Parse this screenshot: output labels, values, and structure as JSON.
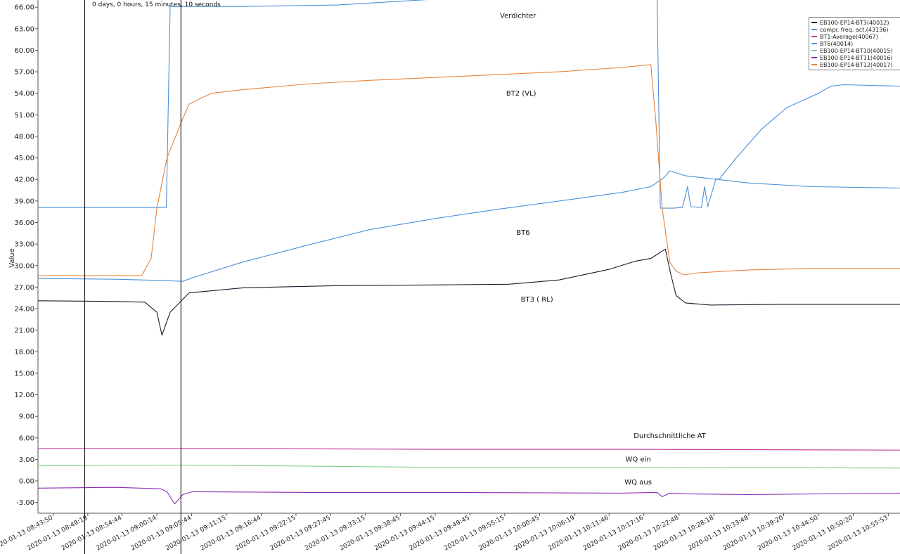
{
  "chart_data": {
    "type": "line",
    "title": "",
    "xlabel": "",
    "ylabel": "Value",
    "ylim": [
      -4.5,
      67
    ],
    "y_ticks": [
      "66.00",
      "63.00",
      "60.00",
      "57.00",
      "54.00",
      "51.00",
      "48.00",
      "45.00",
      "42.00",
      "39.00",
      "36.00",
      "33.00",
      "30.00",
      "27.00",
      "24.00",
      "21.00",
      "18.00",
      "15.00",
      "12.00",
      "9.00",
      "6.00",
      "3.00",
      "0.00",
      "-3.00"
    ],
    "x_ticks": [
      "2020-01-13 08:43:50",
      "2020-01-13 08:49:19",
      "2020-01-13 08:54:44",
      "2020-01-13 09:00:14",
      "2020-01-13 09:05:44",
      "2020-01-13 09:11:15",
      "2020-01-13 09:16:44",
      "2020-01-13 09:22:15",
      "2020-01-13 09:27:45",
      "2020-01-13 09:33:15",
      "2020-01-13 09:38:45",
      "2020-01-13 09:44:15",
      "2020-01-13 09:49:45",
      "2020-01-13 09:55:15",
      "2020-01-13 10:00:45",
      "2020-01-13 10:06:19",
      "2020-01-13 10:11:46",
      "2020-01-13 10:17:16",
      "2020-01-13 10:22:48",
      "2020-01-13 10:28:18",
      "2020-01-13 10:33:48",
      "2020-01-13 10:39:20",
      "2020-01-13 10:44:50",
      "2020-01-13 10:50:20",
      "2020-01-13 10:55:53"
    ],
    "x_minutes": [
      0,
      5.48,
      10.9,
      16.4,
      21.9,
      27.4,
      32.9,
      38.4,
      43.9,
      49.4,
      54.9,
      60.4,
      65.9,
      71.4,
      76.9,
      82.5,
      87.9,
      93.4,
      98.97,
      104.5,
      110.0,
      115.5,
      121.0,
      126.5,
      132.05
    ],
    "xlim_minutes": [
      -2.4,
      133.9
    ],
    "grid": false,
    "legend_position": "top-right",
    "duration_label": "0 days, 0 hours, 15 minutes, 10 seconds",
    "cursor_lines_minutes": [
      5.0,
      20.2
    ],
    "series": [
      {
        "name": "EB100-EP14-BT3(40012)",
        "color": "#1a1a2e",
        "x": [
          -2.4,
          10,
          14.5,
          16.4,
          17.2,
          18.5,
          21.5,
          30,
          45,
          60,
          72,
          80,
          88,
          92,
          94.5,
          96.8,
          97.6,
          98.5,
          100,
          104,
          115,
          133.9
        ],
        "y": [
          25.1,
          25.0,
          24.9,
          23.5,
          20.3,
          23.5,
          26.2,
          26.9,
          27.2,
          27.3,
          27.4,
          28.0,
          29.5,
          30.6,
          31.0,
          32.3,
          29.0,
          25.8,
          24.8,
          24.5,
          24.6,
          24.6
        ]
      },
      {
        "name": "compr. freq. act.(43136)",
        "color": "#4a90d9",
        "x": [
          -2.4,
          17.9,
          18.5,
          30,
          45,
          60,
          95.5,
          96.0,
          98.0,
          99.5,
          100.3,
          100.8,
          102.5,
          103.0,
          103.5,
          104.8,
          105.3,
          108,
          110,
          112,
          116,
          119,
          121,
          123,
          125,
          133.9
        ],
        "y": [
          38.1,
          38.1,
          66.1,
          66.1,
          66.3,
          67.1,
          67.1,
          38.0,
          38.0,
          38.1,
          41.0,
          38.2,
          38.1,
          41.0,
          38.2,
          42.1,
          42.0,
          45.0,
          47.0,
          49.0,
          52.0,
          53.2,
          54.0,
          55.0,
          55.2,
          55.0
        ]
      },
      {
        "name": "BT1-Average(40067)",
        "color": "#c03aa0",
        "x": [
          -2.4,
          30,
          60,
          90,
          133.9
        ],
        "y": [
          4.5,
          4.5,
          4.4,
          4.4,
          4.3
        ]
      },
      {
        "name": "BT6(40014)",
        "color": "#4a90d9",
        "x": [
          -2.4,
          10,
          18,
          20.5,
          22,
          30,
          40,
          50,
          60,
          70,
          80,
          90,
          94.5,
          96.5,
          97.5,
          100,
          110,
          120,
          133.9
        ],
        "y": [
          28.2,
          28.1,
          27.9,
          27.8,
          28.3,
          30.5,
          32.8,
          35.0,
          36.5,
          37.8,
          39.0,
          40.2,
          41.0,
          42.2,
          43.2,
          42.5,
          41.5,
          41.0,
          40.8
        ]
      },
      {
        "name": "EB100-EP14-BT10(40015)",
        "color": "#7fd18b",
        "x": [
          -2.4,
          20,
          35,
          60,
          90,
          133.9
        ],
        "y": [
          2.1,
          2.2,
          2.1,
          1.9,
          1.9,
          1.8
        ]
      },
      {
        "name": "EB100-EP14-BT11(40016)",
        "color": "#8a2db5",
        "x": [
          -2.4,
          10,
          17.0,
          18.0,
          19.2,
          20.5,
          22,
          40,
          60,
          90,
          95.5,
          96.3,
          97.5,
          100,
          110,
          133.9
        ],
        "y": [
          -1.0,
          -0.9,
          -1.1,
          -1.5,
          -3.2,
          -1.9,
          -1.5,
          -1.6,
          -1.6,
          -1.7,
          -1.6,
          -2.2,
          -1.7,
          -1.8,
          -1.9,
          -1.7
        ]
      },
      {
        "name": "EB100-EP14-BT12(40017)",
        "color": "#e8833a",
        "x": [
          -2.4,
          10,
          14.0,
          15.5,
          16.4,
          18.0,
          20.5,
          21.5,
          25,
          30,
          40,
          50,
          60,
          70,
          80,
          90,
          94.5,
          95.3,
          96.3,
          97.5,
          98.5,
          99.8,
          102,
          110,
          120,
          133.9
        ],
        "y": [
          28.6,
          28.6,
          28.6,
          31.0,
          38.0,
          45.0,
          50.5,
          52.5,
          54.0,
          54.5,
          55.3,
          55.8,
          56.2,
          56.6,
          57.0,
          57.6,
          58.0,
          50.0,
          38.0,
          30.5,
          29.2,
          28.7,
          29.0,
          29.4,
          29.6,
          29.6
        ]
      }
    ],
    "annotations": [
      {
        "text": "Verdichter",
        "x": 73.5,
        "y": 64.5
      },
      {
        "text": "BT2 (VL)",
        "x": 74.0,
        "y": 53.7
      },
      {
        "text": "BT6",
        "x": 74.3,
        "y": 34.3
      },
      {
        "text": "BT3 ( RL)",
        "x": 76.5,
        "y": 25.0
      },
      {
        "text": "Durchschnittliche AT",
        "x": 97.5,
        "y": 6.0
      },
      {
        "text": "WQ ein",
        "x": 92.5,
        "y": 2.7
      },
      {
        "text": "WQ aus",
        "x": 92.5,
        "y": -0.5
      }
    ]
  }
}
